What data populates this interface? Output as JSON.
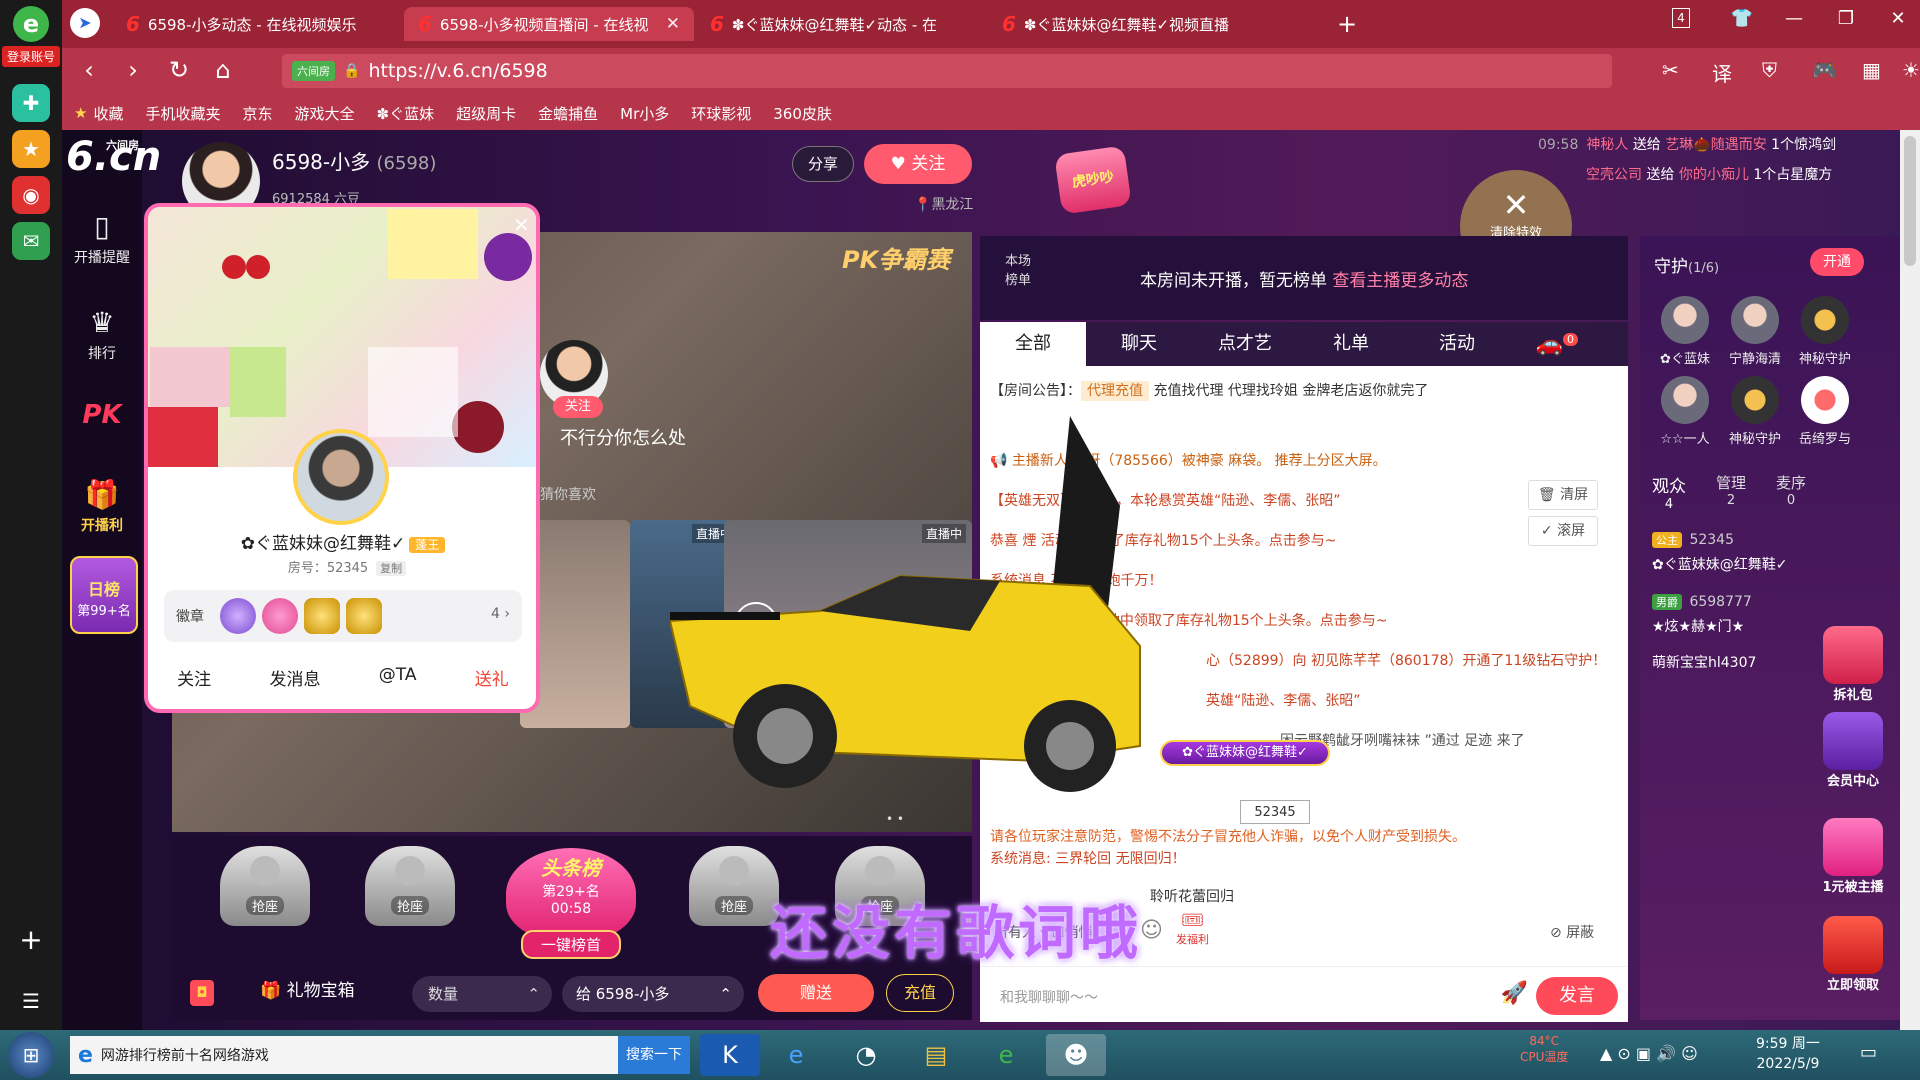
{
  "browser": {
    "login_label": "登录账号",
    "tabs": [
      {
        "title": "6598-小多动态 - 在线视频娱乐",
        "active": false
      },
      {
        "title": "6598-小多视频直播间 - 在线视",
        "active": true
      },
      {
        "title": "✽ぐ蓝妹妹@红舞鞋✓动态 - 在",
        "active": false
      },
      {
        "title": "✽ぐ蓝妹妹@红舞鞋✓视频直播",
        "active": false
      }
    ],
    "tab_count": "4",
    "url": "https://v.6.cn/6598",
    "url_badge": "六间房",
    "bookmarks": [
      "收藏",
      "手机收藏夹",
      "京东",
      "游戏大全",
      "✽ぐ蓝妹",
      "超级周卡",
      "金蟾捕鱼",
      "Mr小多",
      "环球影视",
      "360皮肤"
    ]
  },
  "site": {
    "logo": "6.cn",
    "logo_sub": "六间房",
    "nav": [
      {
        "label": "开播提醒",
        "icon": "phone-icon"
      },
      {
        "label": "排行",
        "icon": "crown-icon"
      },
      {
        "label": "PK",
        "icon": "pk-icon"
      },
      {
        "label": "开播利",
        "icon": "gift-icon"
      }
    ],
    "rank_badge": {
      "title": "日榜",
      "rank": "第99+名"
    }
  },
  "anchor": {
    "name": "6598-小多",
    "id": "(6598)",
    "stats": "6912584 六豆",
    "share": "分享",
    "follow": "关注",
    "location": "黑龙江"
  },
  "gift_ticker": {
    "time": "09:58",
    "lines": [
      {
        "user": "神秘人",
        "action": "送给",
        "target": "艺琳🌰随遇而安",
        "gift": "1个惊鸿剑"
      },
      {
        "user": "空壳公司",
        "action": "送给",
        "target": "你的小痴儿",
        "gift": "1个占星魔方"
      }
    ],
    "clear_effects": "清除特效",
    "badge": "虎吵吵"
  },
  "video": {
    "pk_title": "PK争霸赛",
    "caption": "不行分你怎么处",
    "guess": "猜你喜欢",
    "follow_btn": "关注",
    "thumb_tags": [
      "直播中",
      "直播中"
    ],
    "pagination": "• •"
  },
  "seats": {
    "labels": [
      "抢座",
      "抢座",
      "抢座",
      "抢座"
    ],
    "headline": {
      "title": "头条榜",
      "rank": "第29+名",
      "time": "00:58",
      "button": "一键榜首"
    }
  },
  "giftbar": {
    "box_label": "礼物宝箱",
    "qty_placeholder": "数量",
    "target": "给  6598-小多",
    "send": "赠送",
    "recharge": "充值"
  },
  "rank_header": {
    "tag": "本场榜单",
    "message": "本房间未开播，暂无榜单",
    "link": "查看主播更多动态"
  },
  "chat": {
    "tabs": [
      "全部",
      "聊天",
      "点才艺",
      "礼单",
      "活动"
    ],
    "cart_count": "0",
    "notice_prefix": "【房间公告】：",
    "notice_tag": "代理充值",
    "notice_text": "充值找代理 代理找玲姐 金牌老店返你就完了",
    "messages": [
      "主播新人 哦呀（785566）被神豪 麻袋。 推荐上分区大屏。",
      "【英雄无双】已开启，本轮悬赏英雄“陆逊、李儒、张昭”",
      "恭喜 煙 活动中领取了库存礼物15个上头条。点击参与~",
      "系统消息 不误！一炮千万！",
      "恭喜 ╋№ 运扭蛋活动中领取了库存礼物15个上头条。点击参与~",
      "心（52899）向 初见陈芊芊（860178）开通了11级钻石守护！",
      "英雄“陆逊、李儒、张昭”",
      "困云野鹤龇牙咧嘴袜袜 ”通过 足迹 来了"
    ],
    "clean": "清屏",
    "scroll": "滚屏",
    "warning": "请各位玩家注意防范，警惕不法分子冒充他人诈骗，以免个人财产受到损失。",
    "system_msg": "系统消息: 三界轮回 无限回归！",
    "song": "聆听花蕾回归",
    "to_all": "所有人",
    "private": "悄悄",
    "block": "屏蔽",
    "benefit": "发福利",
    "input_placeholder": "和我聊聊聊～～",
    "send": "发言"
  },
  "lyrics": "还没有歌词哦",
  "car_plate": {
    "name": "✿ぐ蓝妹妹@红舞鞋✓",
    "number": "52345"
  },
  "guard": {
    "title": "守护",
    "count": "(1/6)",
    "open": "开通",
    "members": [
      "✿ぐ蓝妹",
      "宁静海清",
      "神秘守护",
      "☆☆一人",
      "神秘守护",
      "岳绮罗与"
    ],
    "aud_tabs": [
      {
        "label": "观众",
        "count": "4"
      },
      {
        "label": "管理",
        "count": "2"
      },
      {
        "label": "麦序",
        "count": "0"
      }
    ],
    "audience": [
      {
        "id": "52345",
        "name": "✿ぐ蓝妹妹@红舞鞋✓",
        "level": "公主"
      },
      {
        "id": "6598777",
        "name": "★炫★赫★门★",
        "level": "男爵"
      },
      {
        "id": "",
        "name": "萌新宝宝hl4307",
        "level": ""
      }
    ],
    "promos": [
      "拆礼包",
      "会员中心",
      "1元被主播",
      "立即领取"
    ]
  },
  "profile_card": {
    "name": "✿ぐ蓝妹妹@红舞鞋✓",
    "badge": "蓬王",
    "room_label": "房号：52345",
    "copy": "复制",
    "medals_label": "徽章",
    "medal_count": "4",
    "actions": [
      "关注",
      "发消息",
      "@TA",
      "送礼"
    ]
  },
  "taskbar": {
    "search_text": "网游排行榜前十名网络游戏",
    "search_btn": "搜索一下",
    "cpu": "84°C",
    "cpu_label": "CPU温度",
    "time": "9:59 周一",
    "date": "2022/5/9"
  }
}
